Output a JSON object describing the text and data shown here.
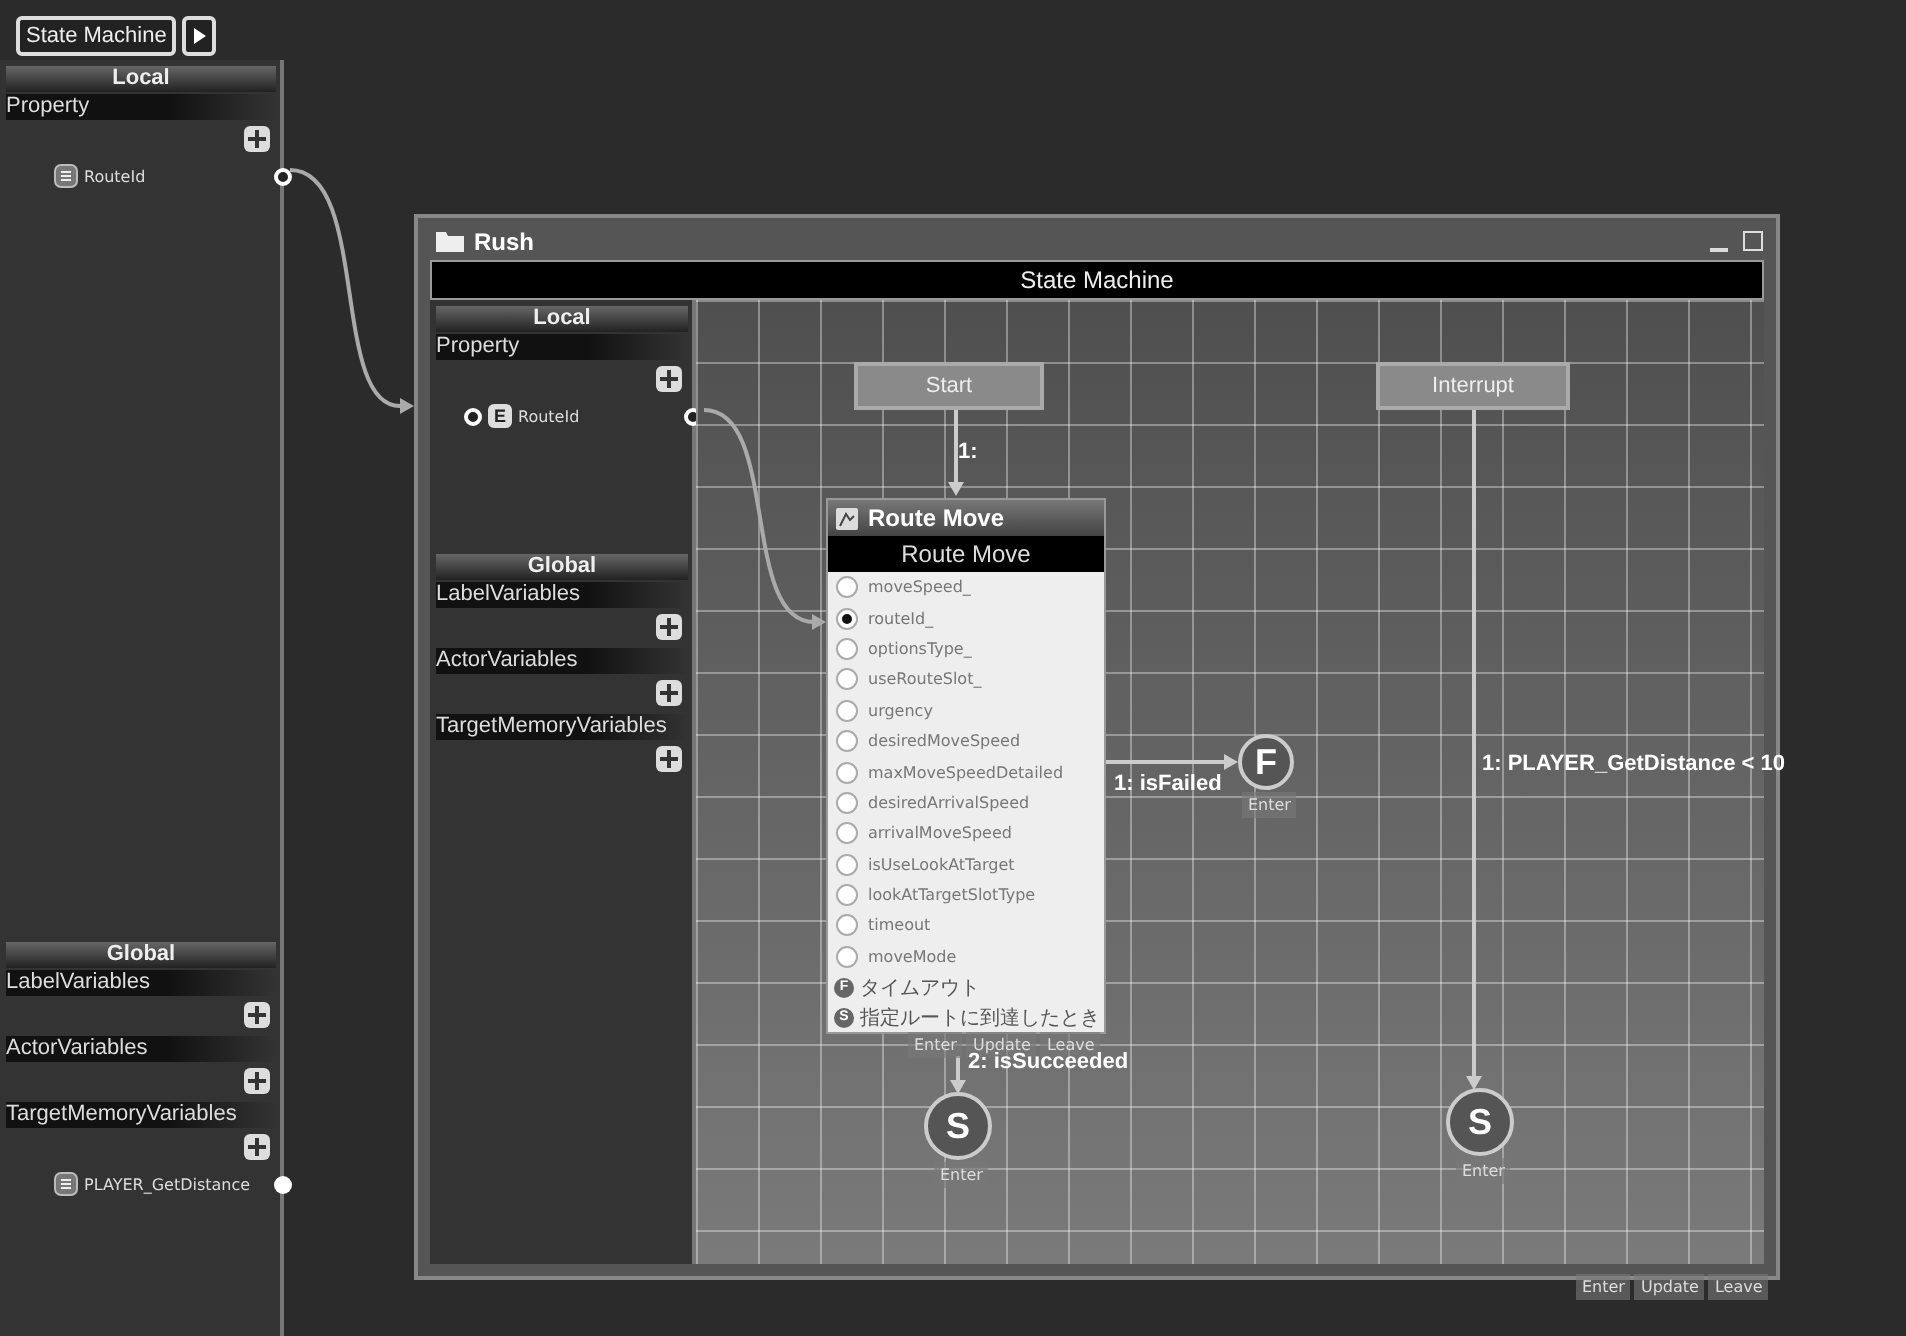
{
  "toolbar": {
    "breadcrumb": "State Machine"
  },
  "side_panel": {
    "sections": [
      {
        "title": "Local",
        "groups": [
          {
            "name": "Property",
            "items": [
              {
                "name": "RouteId"
              }
            ]
          }
        ]
      },
      {
        "title": "Global",
        "groups": [
          {
            "name": "LabelVariables"
          },
          {
            "name": "ActorVariables"
          },
          {
            "name": "TargetMemoryVariables",
            "items": [
              {
                "name": "PLAYER_GetDistance"
              }
            ]
          }
        ]
      }
    ]
  },
  "window": {
    "title": "Rush",
    "header": "State Machine",
    "panel": {
      "sections": [
        {
          "title": "Local",
          "groups": [
            {
              "name": "Property",
              "items": [
                {
                  "name": "RouteId",
                  "badge": "E"
                }
              ]
            }
          ]
        },
        {
          "title": "Global",
          "groups": [
            {
              "name": "LabelVariables"
            },
            {
              "name": "ActorVariables"
            },
            {
              "name": "TargetMemoryVariables"
            }
          ]
        }
      ]
    },
    "nodes": [
      {
        "kind": "entry",
        "label": "Start"
      },
      {
        "kind": "entry",
        "label": "Interrupt"
      },
      {
        "kind": "action",
        "title": "Route Move",
        "subtitle": "Route Move",
        "params": [
          {
            "name": "moveSpeed_",
            "selected": false
          },
          {
            "name": "routeId_",
            "selected": true
          },
          {
            "name": "optionsType_",
            "selected": false
          },
          {
            "name": "useRouteSlot_",
            "selected": false
          },
          {
            "name": "urgency",
            "selected": false
          },
          {
            "name": "desiredMoveSpeed",
            "selected": false
          },
          {
            "name": "maxMoveSpeedDetailed",
            "selected": false
          },
          {
            "name": "desiredArrivalSpeed",
            "selected": false
          },
          {
            "name": "arrivalMoveSpeed",
            "selected": false
          },
          {
            "name": "isUseLookAtTarget",
            "selected": false
          },
          {
            "name": "lookAtTargetSlotType",
            "selected": false
          },
          {
            "name": "timeout",
            "selected": false
          },
          {
            "name": "moveMode",
            "selected": false
          }
        ],
        "outcomes": [
          {
            "badge": "F",
            "label": "タイムアウト"
          },
          {
            "badge": "S",
            "label": "指定ルートに到達したとき"
          }
        ],
        "events": [
          "Enter",
          "Update",
          "Leave"
        ]
      },
      {
        "kind": "terminal",
        "letter": "F",
        "events": [
          "Enter"
        ]
      },
      {
        "kind": "terminal",
        "letter": "S",
        "events": [
          "Enter"
        ]
      },
      {
        "kind": "terminal",
        "letter": "S",
        "events": [
          "Enter"
        ]
      }
    ],
    "transitions": [
      {
        "label": "1:"
      },
      {
        "label": "1: isFailed"
      },
      {
        "label": "2: isSucceeded"
      },
      {
        "label": "1: PLAYER_GetDistance < 10"
      }
    ]
  },
  "footer_events": [
    "Enter",
    "Update",
    "Leave"
  ]
}
